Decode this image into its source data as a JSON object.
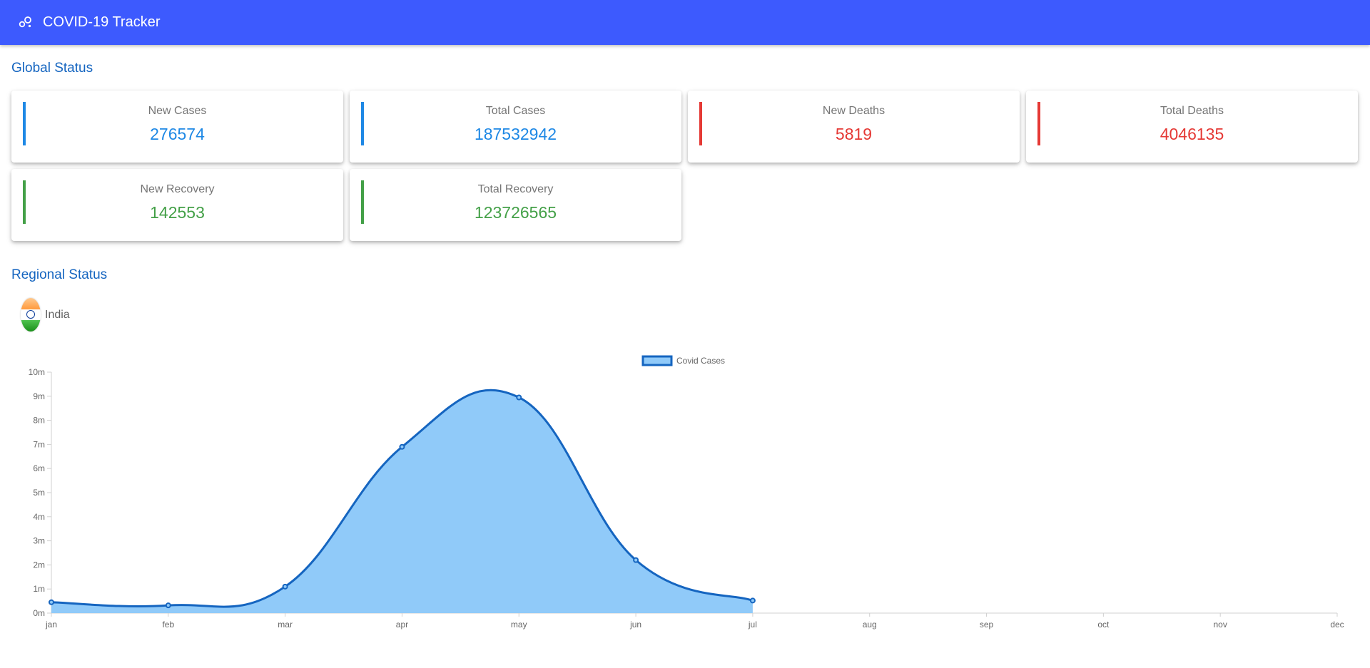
{
  "header": {
    "title": "COVID-19 Tracker",
    "icon": "bubbles-icon",
    "color": "#3d5afe"
  },
  "global": {
    "title": "Global Status",
    "cards": [
      {
        "label": "New Cases",
        "value": "276574",
        "color": "#1e88e5"
      },
      {
        "label": "Total Cases",
        "value": "187532942",
        "color": "#1e88e5"
      },
      {
        "label": "New Deaths",
        "value": "5819",
        "color": "#e53935"
      },
      {
        "label": "Total Deaths",
        "value": "4046135",
        "color": "#e53935"
      },
      {
        "label": "New Recovery",
        "value": "142553",
        "color": "#43a047"
      },
      {
        "label": "Total Recovery",
        "value": "123726565",
        "color": "#43a047"
      }
    ]
  },
  "regional": {
    "title": "Regional Status",
    "country": "India",
    "flag_icon": "india-flag-icon"
  },
  "chart_data": {
    "type": "area",
    "title": "",
    "xlabel": "",
    "ylabel": "",
    "categories": [
      "jan",
      "feb",
      "mar",
      "apr",
      "may",
      "jun",
      "jul",
      "aug",
      "sep",
      "oct",
      "nov",
      "dec"
    ],
    "y_tick_labels": [
      "0m",
      "1m",
      "2m",
      "3m",
      "4m",
      "5m",
      "6m",
      "7m",
      "8m",
      "9m",
      "10m"
    ],
    "ylim": [
      0,
      10
    ],
    "grid": false,
    "legend_position": "top",
    "series": [
      {
        "name": "Covid Cases",
        "values": [
          0.45,
          0.32,
          1.1,
          6.9,
          8.95,
          2.2,
          0.52
        ],
        "units": "millions",
        "line_color": "#1565c0",
        "fill_color": "#90caf9"
      }
    ]
  }
}
